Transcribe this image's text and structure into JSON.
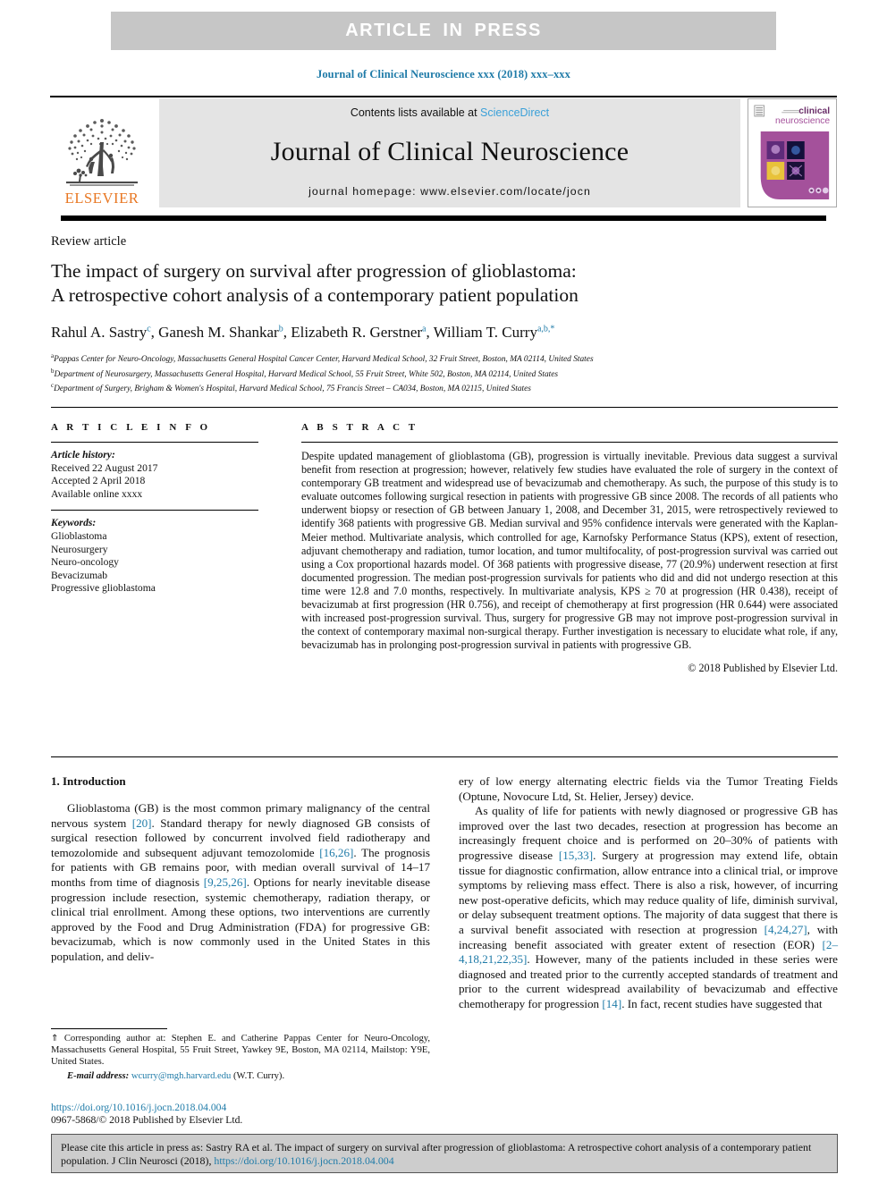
{
  "banner": {
    "text": "ARTICLE IN PRESS"
  },
  "running_head": "Journal of Clinical Neuroscience xxx (2018) xxx–xxx",
  "masthead": {
    "publisher_name": "ELSEVIER",
    "publisher_logo_icon": "elsevier-tree-icon",
    "contents_prefix": "Contents lists available at ",
    "sciencedirect_link": "ScienceDirect",
    "journal_title": "Journal of Clinical Neuroscience",
    "homepage": "journal homepage: www.elsevier.com/locate/jocn",
    "cover": {
      "line1": "clinical",
      "line2": "neuroscience",
      "brand_color": "#a4519b",
      "text_color": "#6b2f6a"
    }
  },
  "article": {
    "type": "Review article",
    "title_line1": "The impact of surgery on survival after progression of glioblastoma:",
    "title_line2": "A retrospective cohort analysis of a contemporary patient population",
    "authors": [
      {
        "name": "Rahul A. Sastry",
        "sup": "c"
      },
      {
        "name": "Ganesh M. Shankar",
        "sup": "b"
      },
      {
        "name": "Elizabeth R. Gerstner",
        "sup": "a"
      },
      {
        "name": "William T. Curry",
        "sup": "a,b,*"
      }
    ],
    "affiliations": [
      {
        "marker": "a",
        "text": "Pappas Center for Neuro-Oncology, Massachusetts General Hospital Cancer Center, Harvard Medical School, 32 Fruit Street, Boston, MA 02114, United States"
      },
      {
        "marker": "b",
        "text": "Department of Neurosurgery, Massachusetts General Hospital, Harvard Medical School, 55 Fruit Street, White 502, Boston, MA 02114, United States"
      },
      {
        "marker": "c",
        "text": "Department of Surgery, Brigham & Women's Hospital, Harvard Medical School, 75 Francis Street – CA034, Boston, MA 02115, United States"
      }
    ]
  },
  "article_info": {
    "heading": "A R T I C L E   I N F O",
    "history_label": "Article history:",
    "history": [
      "Received 22 August 2017",
      "Accepted 2 April 2018",
      "Available online xxxx"
    ],
    "keywords_label": "Keywords:",
    "keywords": [
      "Glioblastoma",
      "Neurosurgery",
      "Neuro-oncology",
      "Bevacizumab",
      "Progressive glioblastoma"
    ]
  },
  "abstract": {
    "heading": "A B S T R A C T",
    "text": "Despite updated management of glioblastoma (GB), progression is virtually inevitable. Previous data suggest a survival benefit from resection at progression; however, relatively few studies have evaluated the role of surgery in the context of contemporary GB treatment and widespread use of bevacizumab and chemotherapy. As such, the purpose of this study is to evaluate outcomes following surgical resection in patients with progressive GB since 2008. The records of all patients who underwent biopsy or resection of GB between January 1, 2008, and December 31, 2015, were retrospectively reviewed to identify 368 patients with progressive GB. Median survival and 95% confidence intervals were generated with the Kaplan-Meier method. Multivariate analysis, which controlled for age, Karnofsky Performance Status (KPS), extent of resection, adjuvant chemotherapy and radiation, tumor location, and tumor multifocality, of post-progression survival was carried out using a Cox proportional hazards model. Of 368 patients with progressive disease, 77 (20.9%) underwent resection at first documented progression. The median post-progression survivals for patients who did and did not undergo resection at this time were 12.8 and 7.0 months, respectively. In multivariate analysis, KPS ≥ 70 at progression (HR 0.438), receipt of bevacizumab at first progression (HR 0.756), and receipt of chemotherapy at first progression (HR 0.644) were associated with increased post-progression survival. Thus, surgery for progressive GB may not improve post-progression survival in the context of contemporary maximal non-surgical therapy. Further investigation is necessary to elucidate what role, if any, bevacizumab has in prolonging post-progression survival in patients with progressive GB.",
    "copyright": "© 2018 Published by Elsevier Ltd."
  },
  "introduction": {
    "heading": "1. Introduction",
    "left_para1_a": "Glioblastoma (GB) is the most common primary malignancy of the central nervous system ",
    "left_ref1": "[20]",
    "left_para1_b": ". Standard therapy for newly diagnosed GB consists of surgical resection followed by concurrent involved field radiotherapy and temozolomide and subsequent adjuvant temozolomide ",
    "left_ref2": "[16,26]",
    "left_para1_c": ". The prognosis for patients with GB remains poor, with median overall survival of 14–17 months from time of diagnosis ",
    "left_ref3": "[9,25,26]",
    "left_para1_d": ". Options for nearly inevitable disease progression include resection, systemic chemotherapy, radiation therapy, or clinical trial enrollment. Among these options, two interventions are currently approved by the Food and Drug Administration (FDA) for progressive GB: bevacizumab, which is now commonly used in the United States in this population, and deliv-",
    "right_para1_cont": "ery of low energy alternating electric fields via the Tumor Treating Fields (Optune, Novocure Ltd, St. Helier, Jersey) device.",
    "right_para2_a": "As quality of life for patients with newly diagnosed or progressive GB has improved over the last two decades, resection at progression has become an increasingly frequent choice and is performed on 20–30% of patients with progressive disease ",
    "right_ref1": "[15,33]",
    "right_para2_b": ". Surgery at progression may extend life, obtain tissue for diagnostic confirmation, allow entrance into a clinical trial, or improve symptoms by relieving mass effect. There is also a risk, however, of incurring new post-operative deficits, which may reduce quality of life, diminish survival, or delay subsequent treatment options. The majority of data suggest that there is a survival benefit associated with resection at progression ",
    "right_ref2": "[4,24,27]",
    "right_para2_c": ", with increasing benefit associated with greater extent of resection (EOR) ",
    "right_ref3": "[2–4,18,21,22,35]",
    "right_para2_d": ". However, many of the patients included in these series were diagnosed and treated prior to the currently accepted standards of treatment and prior to the current widespread availability of bevacizumab and effective chemotherapy for progression ",
    "right_ref4": "[14]",
    "right_para2_e": ". In fact, recent studies have suggested that"
  },
  "footnote": {
    "star": "⇑",
    "corresponding_text": " Corresponding author at: Stephen E. and Catherine Pappas Center for Neuro-Oncology, Massachusetts General Hospital, 55 Fruit Street, Yawkey 9E, Boston, MA 02114, Mailstop: Y9E, United States.",
    "email_label": "E-mail address:",
    "email": "wcurry@mgh.harvard.edu",
    "email_owner": "(W.T. Curry).",
    "doi": "https://doi.org/10.1016/j.jocn.2018.04.004",
    "issn_line": "0967-5868/© 2018 Published by Elsevier Ltd."
  },
  "citation_box": {
    "text_a": "Please cite this article in press as: Sastry RA et al. The impact of surgery on survival after progression of glioblastoma: A retrospective cohort analysis of a contemporary patient population. J Clin Neurosci (2018), ",
    "link": "https://doi.org/10.1016/j.jocn.2018.04.004"
  }
}
